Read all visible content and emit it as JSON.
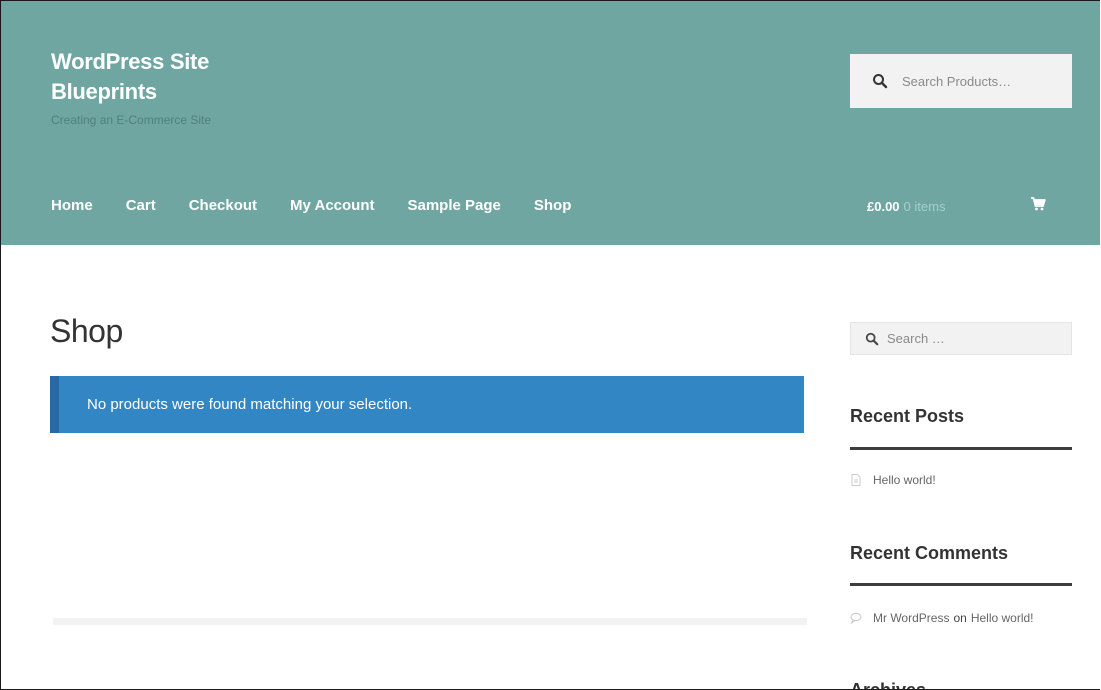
{
  "header": {
    "site_title_line1": "WordPress Site",
    "site_title_line2": "Blueprints",
    "tagline": "Creating an E-Commerce Site",
    "search_placeholder": "Search Products…",
    "nav": [
      "Home",
      "Cart",
      "Checkout",
      "My Account",
      "Sample Page",
      "Shop"
    ],
    "cart": {
      "amount": "£0.00",
      "count": "0 items"
    }
  },
  "main": {
    "page_title": "Shop",
    "notice": "No products were found matching your selection."
  },
  "sidebar": {
    "search_placeholder": "Search …",
    "recent_posts": {
      "title": "Recent Posts",
      "items": [
        "Hello world!"
      ]
    },
    "recent_comments": {
      "title": "Recent Comments",
      "author": "Mr WordPress",
      "connector": "on",
      "post": "Hello world!"
    },
    "archives": {
      "title": "Archives"
    }
  },
  "colors": {
    "header_bg": "#6fa6a2",
    "notice_bg": "#3386c4",
    "notice_border": "#2968a3"
  },
  "icons": [
    "search-icon",
    "cart-icon",
    "document-icon",
    "comment-icon"
  ]
}
